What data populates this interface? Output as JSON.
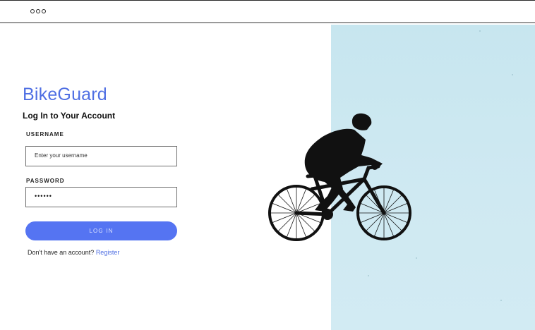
{
  "window": {
    "controls_icon": "ellipsis-dots"
  },
  "brand": {
    "name": "BikeGuard",
    "color": "#4f6fe3"
  },
  "login": {
    "title": "Log In to Your Account",
    "username_label": "USERNAME",
    "username_placeholder": "Enter your username",
    "password_label": "PASSWORD",
    "password_value": "••••••",
    "button_label": "LOG IN",
    "button_color": "#5574f2",
    "no_account_text": "Don't have an account?",
    "register_label": "Register"
  },
  "hero": {
    "background": "#cfe9f2",
    "illustration": "cyclist-silhouette"
  }
}
